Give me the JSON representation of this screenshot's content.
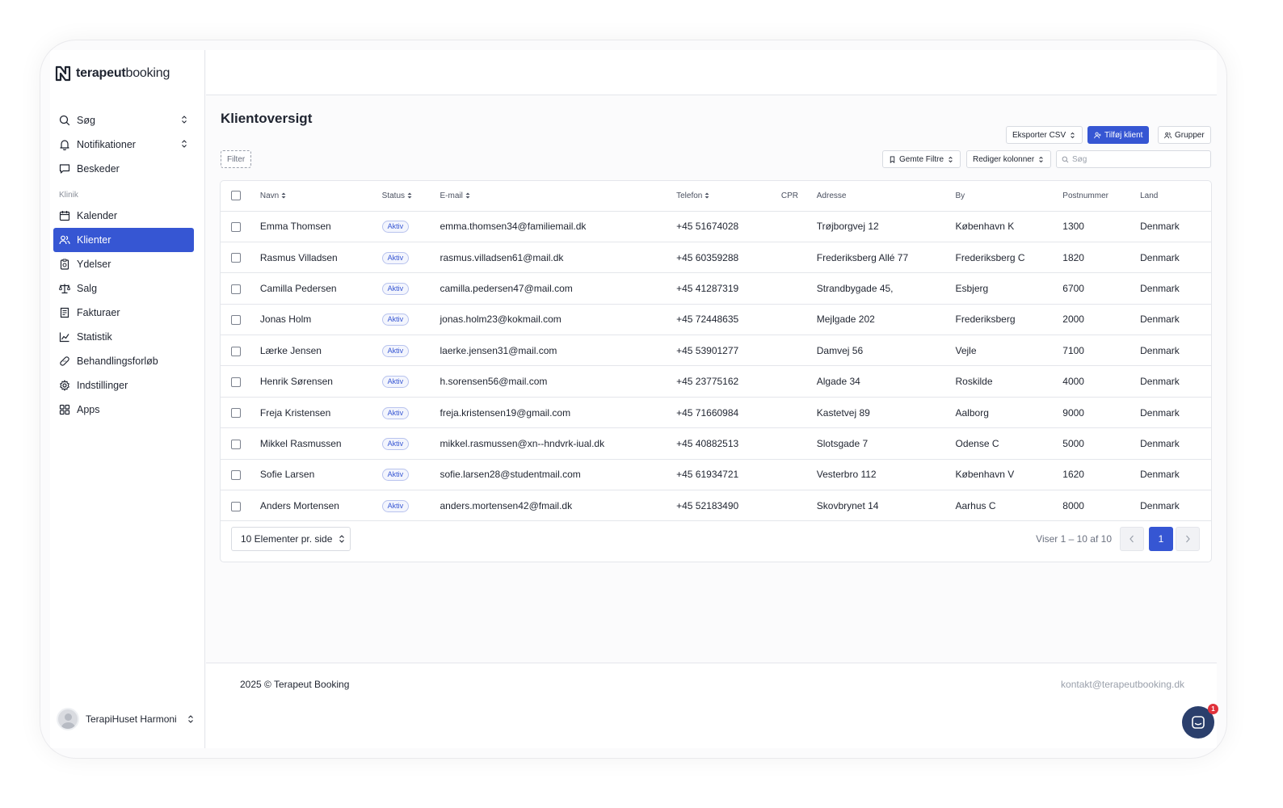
{
  "brand": {
    "name_bold": "terapeut",
    "name_rest": "booking"
  },
  "sidebar": {
    "items_top": [
      {
        "label": "Søg",
        "icon": "search-icon"
      },
      {
        "label": "Notifikationer",
        "icon": "bell-icon"
      },
      {
        "label": "Beskeder",
        "icon": "message-icon"
      }
    ],
    "section_label": "Klinik",
    "items": [
      {
        "label": "Kalender",
        "icon": "calendar-icon"
      },
      {
        "label": "Klienter",
        "icon": "users-icon",
        "active": true
      },
      {
        "label": "Ydelser",
        "icon": "clipboard-icon"
      },
      {
        "label": "Salg",
        "icon": "scale-icon"
      },
      {
        "label": "Fakturaer",
        "icon": "invoice-icon"
      },
      {
        "label": "Statistik",
        "icon": "chart-line-icon"
      },
      {
        "label": "Behandlingsforløb",
        "icon": "bandage-icon"
      },
      {
        "label": "Indstillinger",
        "icon": "gear-icon"
      },
      {
        "label": "Apps",
        "icon": "apps-grid-icon"
      }
    ],
    "user_name": "TerapiHuset Harmoni"
  },
  "main": {
    "title": "Klientoversigt",
    "toolbar": {
      "export_label": "Eksporter CSV",
      "add_client_label": "Tilføj klient",
      "groups_label": "Grupper",
      "filter_label": "Filter",
      "saved_filters_label": "Gemte Filtre",
      "edit_columns_label": "Rediger kolonner",
      "search_placeholder": "Søg"
    },
    "columns": [
      "Navn",
      "Status",
      "E-mail",
      "Telefon",
      "CPR",
      "Adresse",
      "By",
      "Postnummer",
      "Land"
    ],
    "rows": [
      {
        "name": "Emma Thomsen",
        "status": "Aktiv",
        "email": "emma.thomsen34@familiemail.dk",
        "phone": "+45 51674028",
        "cpr": "",
        "address": "Trøjborgvej 12",
        "city": "København K",
        "zip": "1300",
        "country": "Denmark"
      },
      {
        "name": "Rasmus Villadsen",
        "status": "Aktiv",
        "email": "rasmus.villadsen61@mail.dk",
        "phone": "+45 60359288",
        "cpr": "",
        "address": "Frederiksberg Allé 77",
        "city": "Frederiksberg C",
        "zip": "1820",
        "country": "Denmark"
      },
      {
        "name": "Camilla Pedersen",
        "status": "Aktiv",
        "email": "camilla.pedersen47@mail.com",
        "phone": "+45 41287319",
        "cpr": "",
        "address": "Strandbygade 45,",
        "city": "Esbjerg",
        "zip": "6700",
        "country": "Denmark"
      },
      {
        "name": "Jonas Holm",
        "status": "Aktiv",
        "email": "jonas.holm23@kokmail.com",
        "phone": "+45 72448635",
        "cpr": "",
        "address": "Mejlgade 202",
        "city": "Frederiksberg",
        "zip": "2000",
        "country": "Denmark"
      },
      {
        "name": "Lærke Jensen",
        "status": "Aktiv",
        "email": "laerke.jensen31@mail.com",
        "phone": "+45 53901277",
        "cpr": "",
        "address": "Damvej 56",
        "city": "Vejle",
        "zip": "7100",
        "country": "Denmark"
      },
      {
        "name": "Henrik Sørensen",
        "status": "Aktiv",
        "email": "h.sorensen56@mail.com",
        "phone": "+45 23775162",
        "cpr": "",
        "address": "Algade 34",
        "city": "Roskilde",
        "zip": "4000",
        "country": "Denmark"
      },
      {
        "name": "Freja Kristensen",
        "status": "Aktiv",
        "email": "freja.kristensen19@gmail.com",
        "phone": "+45 71660984",
        "cpr": "",
        "address": "Kastetvej 89",
        "city": "Aalborg",
        "zip": "9000",
        "country": "Denmark"
      },
      {
        "name": "Mikkel Rasmussen",
        "status": "Aktiv",
        "email": "mikkel.rasmussen@xn--hndvrk-iual.dk",
        "phone": "+45 40882513",
        "cpr": "",
        "address": "Slotsgade 7",
        "city": "Odense C",
        "zip": "5000",
        "country": "Denmark"
      },
      {
        "name": "Sofie Larsen",
        "status": "Aktiv",
        "email": "sofie.larsen28@studentmail.com",
        "phone": "+45 61934721",
        "cpr": "",
        "address": "Vesterbro 112",
        "city": "København V",
        "zip": "1620",
        "country": "Denmark"
      },
      {
        "name": "Anders Mortensen",
        "status": "Aktiv",
        "email": "anders.mortensen42@fmail.dk",
        "phone": "+45 52183490",
        "cpr": "",
        "address": "Skovbrynet 14",
        "city": "Aarhus C",
        "zip": "8000",
        "country": "Denmark"
      }
    ],
    "pagination": {
      "page_size_label": "10 Elementer pr. side",
      "info": "Viser 1 – 10 af 10",
      "current_page": "1"
    }
  },
  "footer": {
    "copyright": "2025 © Terapeut Booking",
    "contact_email": "kontakt@terapeutbooking.dk"
  },
  "chat": {
    "unread": "1"
  },
  "colors": {
    "accent": "#3656d3",
    "chat": "#2b3f6c",
    "badge": "#e0313b"
  }
}
